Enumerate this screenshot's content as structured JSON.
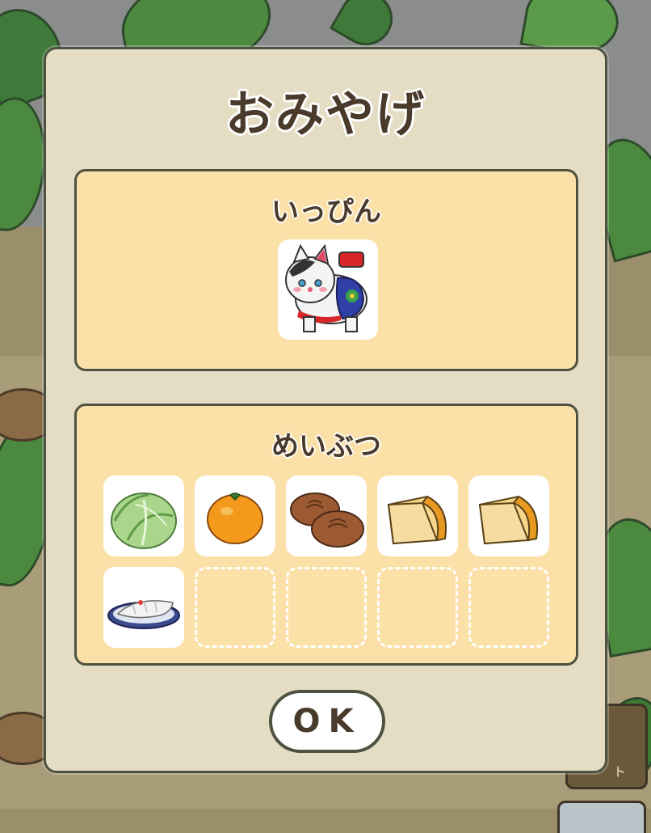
{
  "dialog": {
    "title": "おみやげ",
    "ok_label": "OK"
  },
  "special_section": {
    "title": "いっぴん",
    "items": [
      {
        "icon": "inuhariko-dog-figurine-icon"
      }
    ]
  },
  "local_section": {
    "title": "めいぶつ",
    "items": [
      {
        "icon": "cabbage-icon"
      },
      {
        "icon": "mikan-orange-icon"
      },
      {
        "icon": "manju-buns-icon"
      },
      {
        "icon": "cheese-wedge-icon"
      },
      {
        "icon": "cheese-wedge-icon"
      },
      {
        "icon": "sashimi-plate-icon"
      }
    ],
    "empty_slots": 4
  },
  "background": {
    "side_button_label": "ト"
  }
}
